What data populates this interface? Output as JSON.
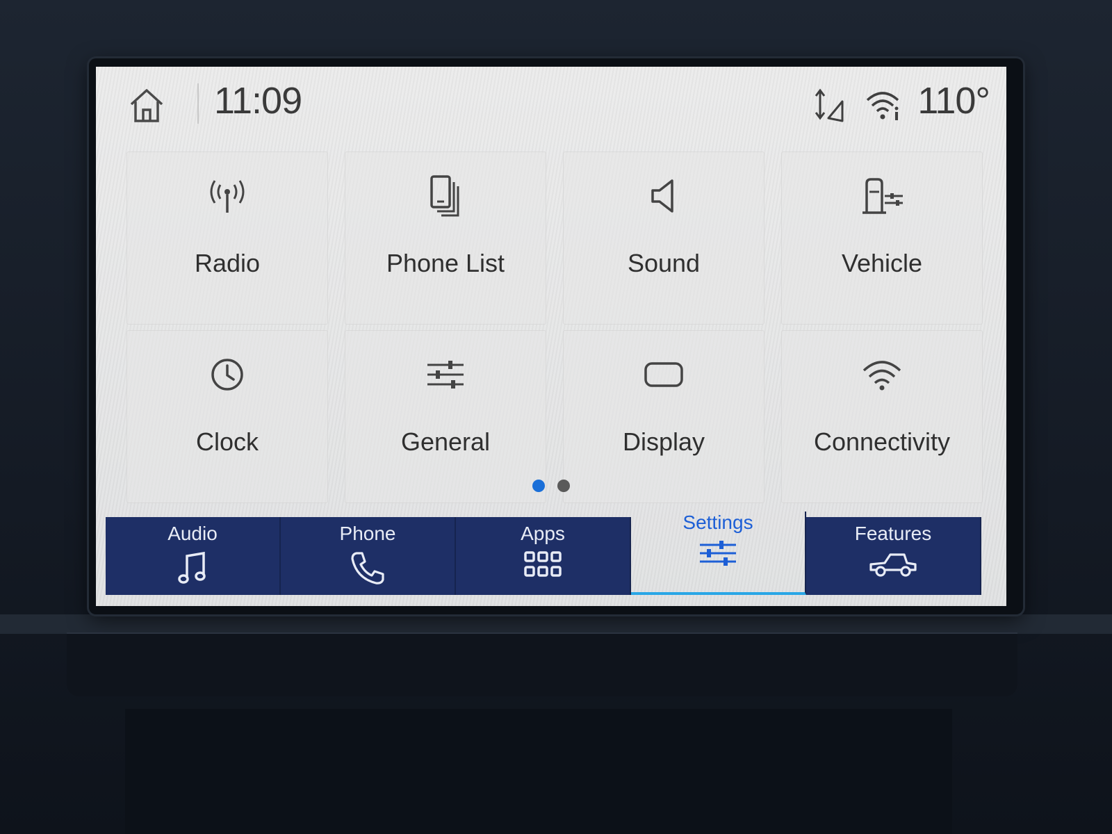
{
  "status_bar": {
    "time": "11:09",
    "temperature": "110°",
    "icons": [
      "home-icon",
      "navigation-signal-icon",
      "wifi-hotspot-icon"
    ]
  },
  "settings_tiles": [
    {
      "label": "Radio",
      "icon": "radio-antenna-icon"
    },
    {
      "label": "Phone List",
      "icon": "phone-list-icon"
    },
    {
      "label": "Sound",
      "icon": "speaker-icon"
    },
    {
      "label": "Vehicle",
      "icon": "vehicle-settings-icon"
    },
    {
      "label": "Clock",
      "icon": "clock-icon"
    },
    {
      "label": "General",
      "icon": "sliders-icon"
    },
    {
      "label": "Display",
      "icon": "display-icon"
    },
    {
      "label": "Connectivity",
      "icon": "wifi-icon"
    }
  ],
  "pagination": {
    "pages": 2,
    "current": 1
  },
  "nav_bar": [
    {
      "label": "Audio",
      "icon": "music-note-icon",
      "active": false
    },
    {
      "label": "Phone",
      "icon": "phone-handset-icon",
      "active": false
    },
    {
      "label": "Apps",
      "icon": "apps-grid-icon",
      "active": false
    },
    {
      "label": "Settings",
      "icon": "settings-sliders-icon",
      "active": true
    },
    {
      "label": "Features",
      "icon": "truck-icon",
      "active": false
    }
  ],
  "colors": {
    "nav_background": "#1e2f66",
    "accent_blue": "#1d5fd6",
    "active_dot": "#1a6fd8"
  }
}
